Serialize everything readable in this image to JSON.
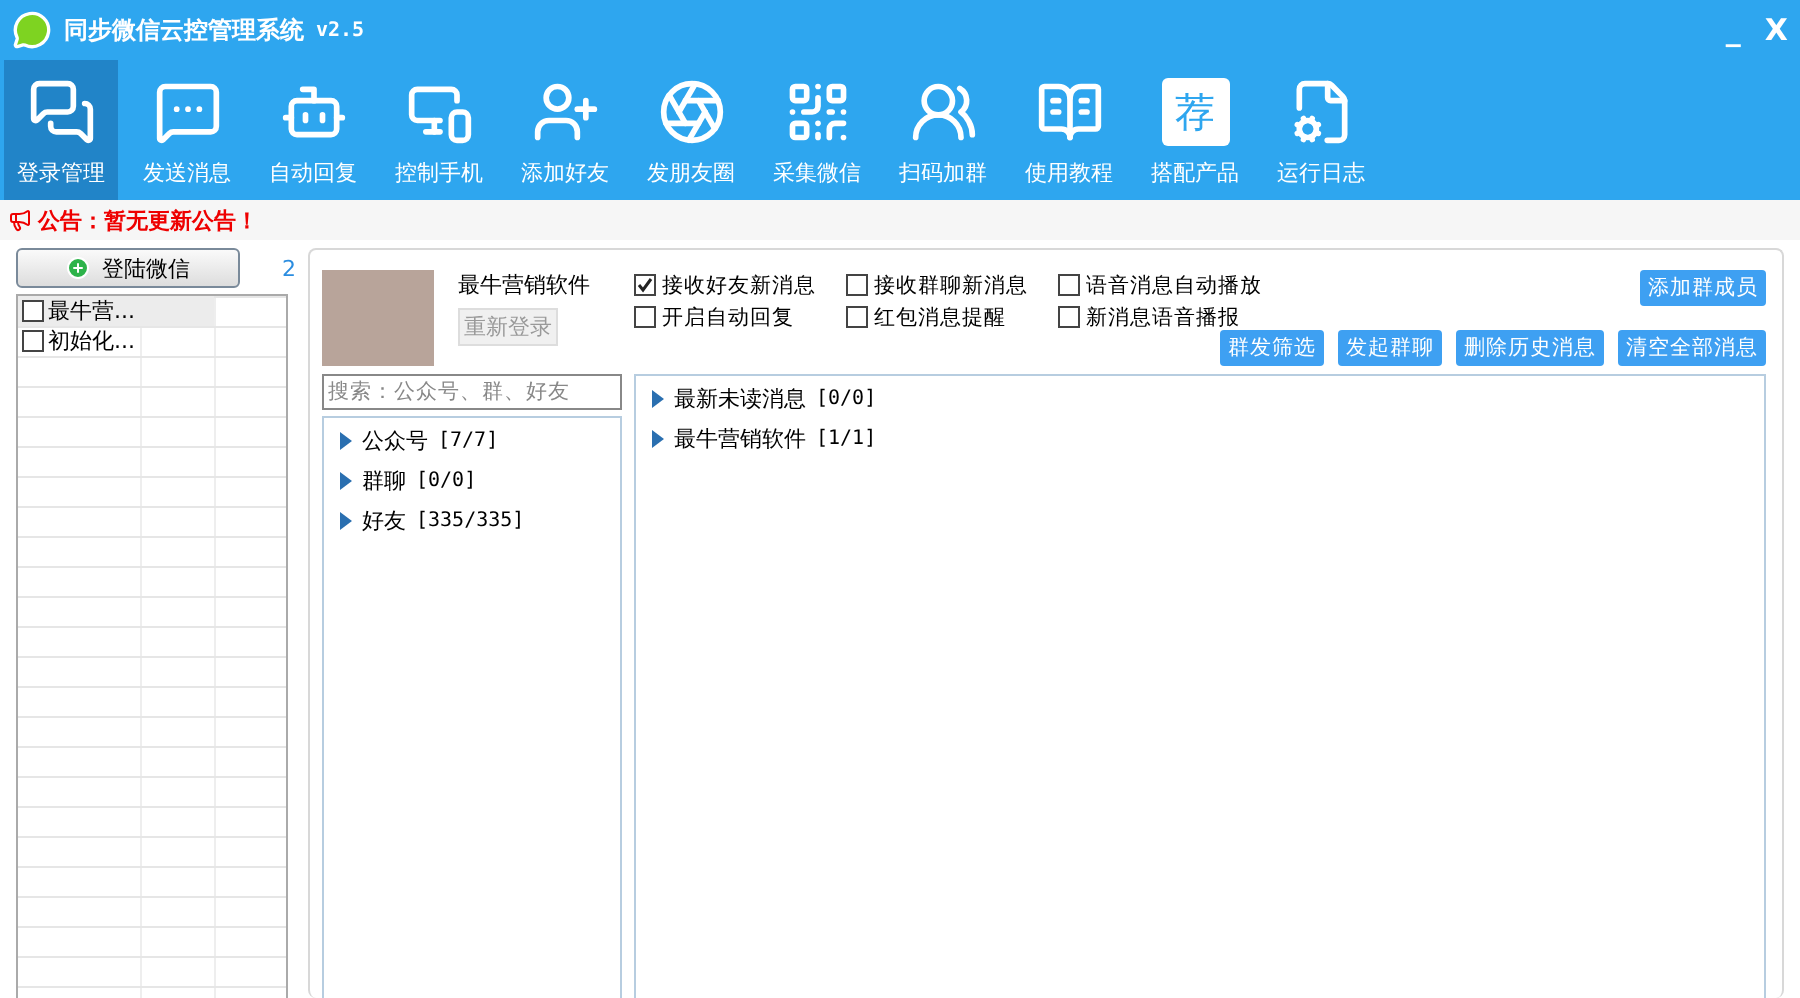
{
  "window": {
    "title": "同步微信云控管理系统",
    "version": "v2.5",
    "controls": [
      "_",
      "X"
    ]
  },
  "toolbar": [
    {
      "label": "登录管理",
      "selected": true
    },
    {
      "label": "发送消息",
      "selected": false
    },
    {
      "label": "自动回复",
      "selected": false
    },
    {
      "label": "控制手机",
      "selected": false
    },
    {
      "label": "添加好友",
      "selected": false
    },
    {
      "label": "发朋友圈",
      "selected": false
    },
    {
      "label": "采集微信",
      "selected": false
    },
    {
      "label": "扫码加群",
      "selected": false
    },
    {
      "label": "使用教程",
      "selected": false
    },
    {
      "label": "搭配产品",
      "badge_text": "荐",
      "selected": false
    },
    {
      "label": "运行日志",
      "selected": false
    }
  ],
  "notice": "公告：暂无更新公告！",
  "login_button": "登陆微信",
  "account_count": "2",
  "accounts": [
    {
      "name": "最牛营...",
      "checked": false,
      "selected": true
    },
    {
      "name": "初始化...",
      "checked": false,
      "selected": false
    }
  ],
  "profile": {
    "name": "最牛营销软件",
    "relogin": "重新登录"
  },
  "options": [
    {
      "label": "接收好友新消息",
      "checked": true
    },
    {
      "label": "开启自动回复",
      "checked": false
    },
    {
      "label": "接收群聊新消息",
      "checked": false
    },
    {
      "label": "红包消息提醒",
      "checked": false
    },
    {
      "label": "语音消息自动播放",
      "checked": false
    },
    {
      "label": "新消息语音播报",
      "checked": false
    }
  ],
  "add_member_button": "添加群成员",
  "action_buttons": [
    "群发筛选",
    "发起群聊",
    "删除历史消息",
    "清空全部消息"
  ],
  "search": {
    "placeholder": "搜索：公众号、群、好友"
  },
  "contacts": [
    {
      "label": "公众号",
      "count": "[7/7]"
    },
    {
      "label": "群聊",
      "count": "[0/0]"
    },
    {
      "label": "好友",
      "count": "[335/335]"
    }
  ],
  "messages": [
    {
      "label": "最新未读消息",
      "count": "[0/0]"
    },
    {
      "label": "最牛营销软件",
      "count": "[1/1]"
    }
  ]
}
